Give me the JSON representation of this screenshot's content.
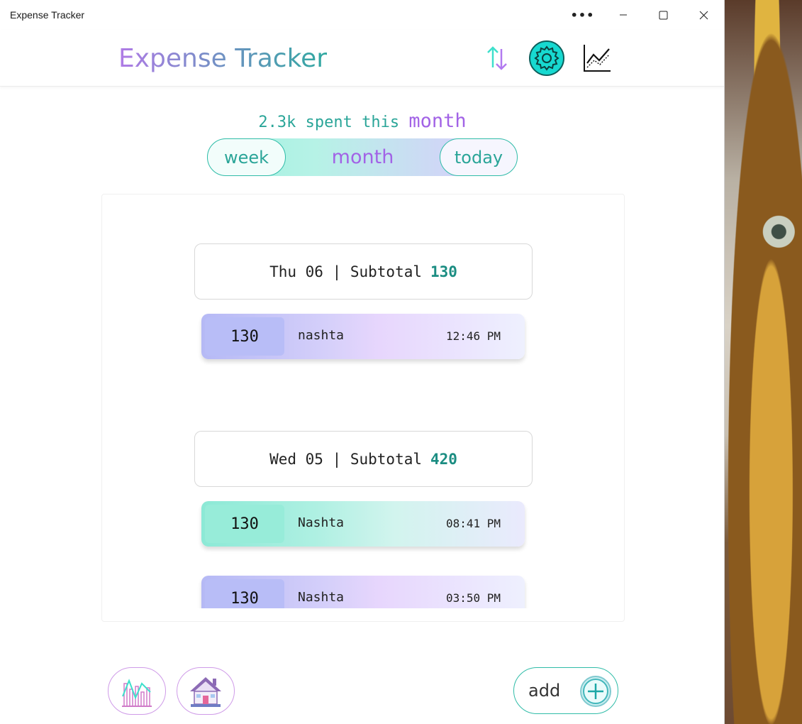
{
  "window": {
    "title": "Expense Tracker",
    "controls": {
      "more": "•••",
      "minimize": "—",
      "maximize": "▢",
      "close": "✕"
    }
  },
  "header": {
    "title": "Expense Tracker",
    "icons": [
      "sort-icon",
      "settings-gear-icon",
      "line-chart-icon"
    ]
  },
  "summary": {
    "text": "2.3k spent this ",
    "period": "month"
  },
  "period_toggle": {
    "options": [
      "week",
      "month",
      "today"
    ],
    "selected": "month"
  },
  "days": [
    {
      "header": "Thu 06 | Subtotal",
      "subtotal": "130",
      "expenses": [
        {
          "amount": "130",
          "description": "nashta",
          "time": "12:46 PM",
          "style": "lilac"
        }
      ]
    },
    {
      "header": "Wed 05 | Subtotal",
      "subtotal": "420",
      "expenses": [
        {
          "amount": "130",
          "description": "Nashta",
          "time": "08:41 PM",
          "style": "mint"
        },
        {
          "amount": "130",
          "description": "Nashta",
          "time": "03:50 PM",
          "style": "lilac"
        }
      ]
    }
  ],
  "bottom_nav": {
    "left_buttons": [
      "bar-chart-icon",
      "home-icon"
    ],
    "add_label": "add"
  },
  "colors": {
    "teal": "#2aa598",
    "purple": "#a263e6",
    "subtotal": "#1b8d82"
  }
}
